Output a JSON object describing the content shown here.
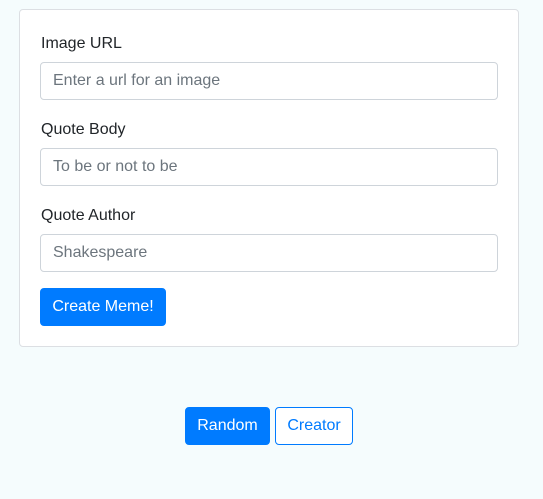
{
  "form": {
    "image_url": {
      "label": "Image URL",
      "placeholder": "Enter a url for an image"
    },
    "quote_body": {
      "label": "Quote Body",
      "placeholder": "To be or not to be"
    },
    "quote_author": {
      "label": "Quote Author",
      "placeholder": "Shakespeare"
    },
    "submit_label": "Create Meme!"
  },
  "nav": {
    "random_label": "Random",
    "creator_label": "Creator"
  },
  "colors": {
    "primary": "#007bff",
    "background": "#f5fcfd",
    "card_border": "#dcdfe3"
  }
}
